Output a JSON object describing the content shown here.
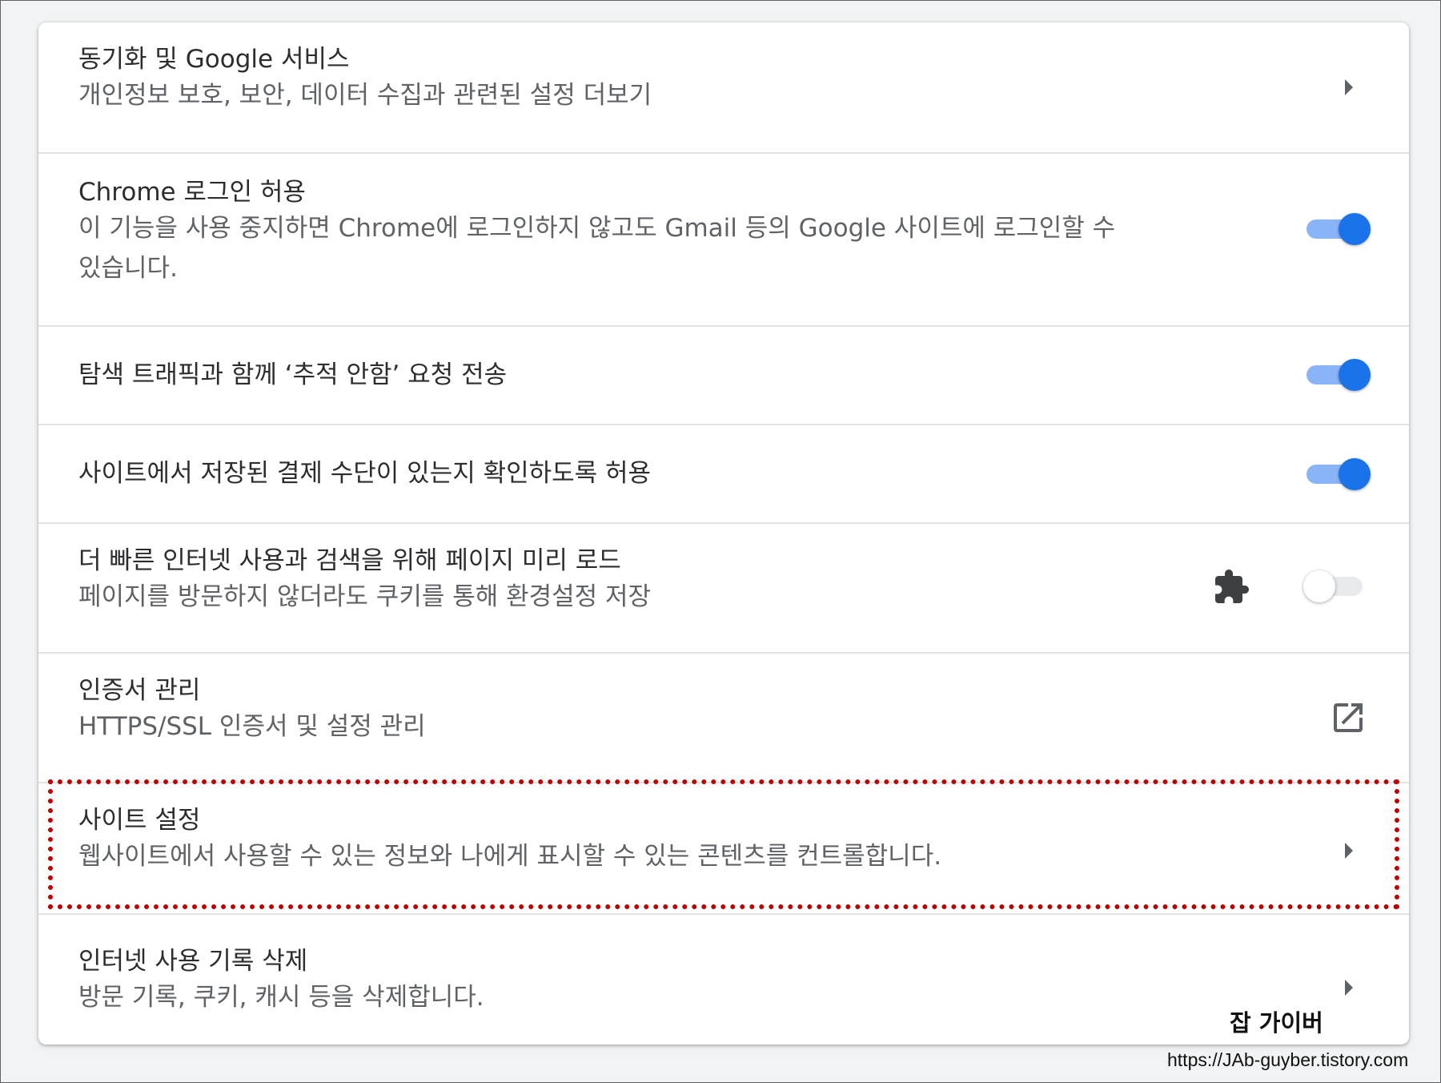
{
  "rows": [
    {
      "title": "동기화 및 Google 서비스",
      "subtitle": "개인정보 보호, 보안, 데이터 수집과 관련된 설정 더보기",
      "control": "chevron-right-icon"
    },
    {
      "title": "Chrome 로그인 허용",
      "subtitle": "이 기능을 사용 중지하면 Chrome에 로그인하지 않고도 Gmail 등의 Google 사이트에 로그인할 수 있습니다.",
      "control": "toggle",
      "toggle_on": true
    },
    {
      "title": "탐색 트래픽과 함께 ‘추적 안함’ 요청 전송",
      "control": "toggle",
      "toggle_on": true
    },
    {
      "title": "사이트에서 저장된 결제 수단이 있는지 확인하도록 허용",
      "control": "toggle",
      "toggle_on": true
    },
    {
      "title": "더 빠른 인터넷 사용과 검색을 위해 페이지 미리 로드",
      "subtitle": "페이지를 방문하지 않더라도 쿠키를 통해 환경설정 저장",
      "control": "toggle",
      "toggle_on": false,
      "extension_icon": "puzzle-icon"
    },
    {
      "title": "인증서 관리",
      "subtitle": "HTTPS/SSL 인증서 및 설정 관리",
      "control": "open-in-new-icon"
    },
    {
      "title": "사이트 설정",
      "subtitle": "웹사이트에서 사용할 수 있는 정보와 나에게 표시할 수 있는 콘텐츠를 컨트롤합니다.",
      "control": "chevron-right-icon",
      "highlighted": true
    },
    {
      "title": "인터넷 사용 기록 삭제",
      "subtitle": "방문 기록, 쿠키, 캐시 등을 삭제합니다.",
      "control": "chevron-right-icon"
    }
  ],
  "watermark": {
    "name": "잡 가이버",
    "url": "https://JAb-guyber.tistory.com"
  },
  "colors": {
    "toggle_on_knob": "#1a73e8",
    "toggle_on_track": "#8ab4f8",
    "highlight_border": "#c00000"
  }
}
